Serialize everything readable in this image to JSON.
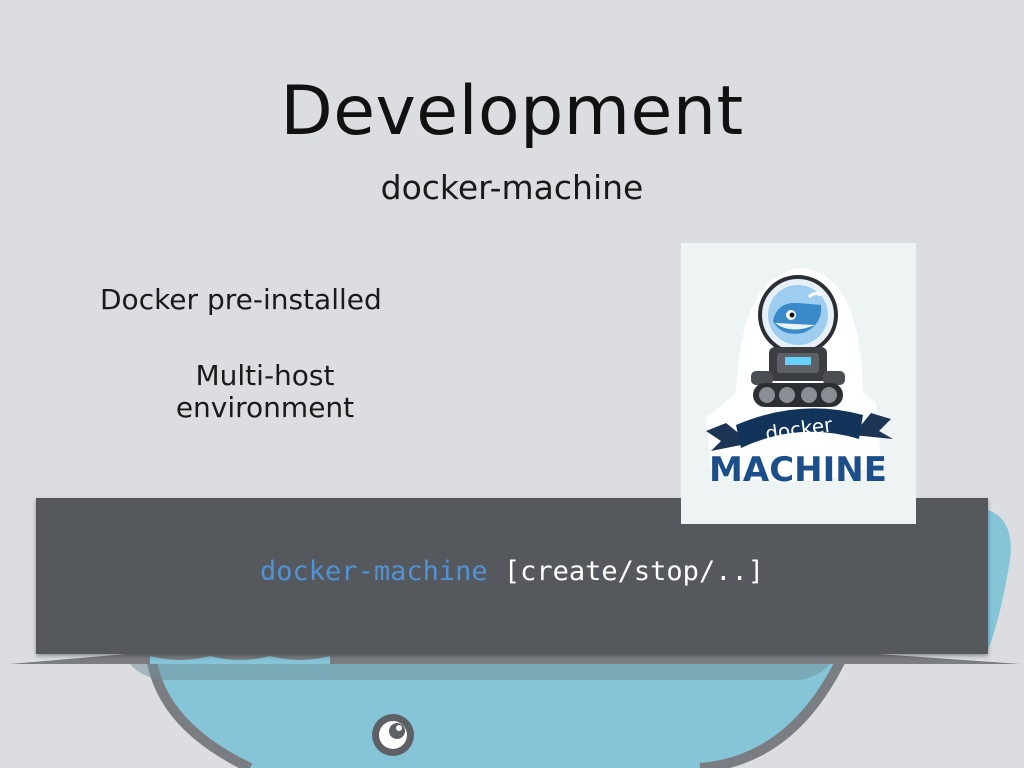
{
  "slide": {
    "title": "Development",
    "subtitle": "docker-machine",
    "bullets": [
      "Docker pre-installed",
      "Multi-host environment"
    ],
    "code": {
      "command": "docker-machine",
      "args": "[create/stop/..]"
    },
    "logo": {
      "wordmark_top": "docker",
      "wordmark_bottom": "MACHINE"
    }
  },
  "colors": {
    "background": "#dcdde0",
    "code_panel": "#55585c",
    "code_command": "#4f93d6",
    "whale": "#86c4d8"
  }
}
